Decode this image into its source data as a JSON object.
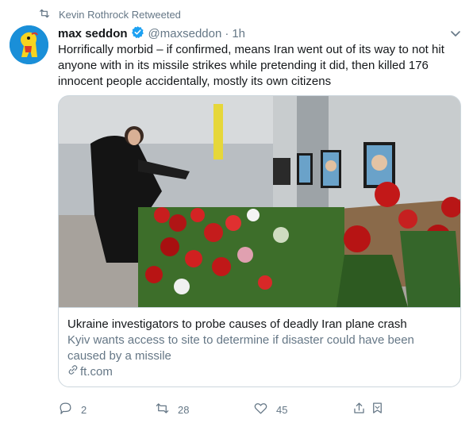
{
  "retweet": {
    "icon": "retweet-icon",
    "text": "Kevin Rothrock Retweeted"
  },
  "tweet": {
    "author_name": "max seddon",
    "verified_icon": "verified-badge-icon",
    "handle": "@maxseddon",
    "separator": "·",
    "time": "1h",
    "text": "Horrifically morbid – if confirmed, means Iran went out of its way to not hit anyone with in its missile strikes while pretending it did, then killed 176 innocent people accidentally, mostly its own citizens"
  },
  "card": {
    "title": "Ukraine investigators to probe causes of deadly Iran plane crash",
    "description": "Kyiv wants access to site to determine if disaster could have been caused by a missile",
    "domain": "ft.com"
  },
  "actions": {
    "reply_count": "2",
    "retweet_count": "28",
    "like_count": "45"
  },
  "colors": {
    "accent": "#1da1f2",
    "secondary_text": "#657786",
    "border": "#ccd6dd"
  }
}
